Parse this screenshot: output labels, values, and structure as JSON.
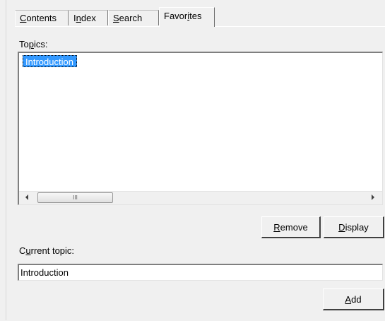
{
  "tabs": {
    "contents": {
      "pre": "",
      "key": "C",
      "post": "ontents"
    },
    "index": {
      "pre": "I",
      "key": "n",
      "post": "dex"
    },
    "search": {
      "pre": "",
      "key": "S",
      "post": "earch"
    },
    "favorites": {
      "pre": "Favor",
      "key": "i",
      "post": "tes"
    }
  },
  "topics": {
    "label": {
      "pre": "To",
      "key": "p",
      "post": "ics:"
    },
    "items": [
      "Introduction"
    ],
    "selected_index": 0
  },
  "scrollbar": {
    "left_icon": "chevron-left-icon",
    "right_icon": "chevron-right-icon",
    "thumb_grip": "III"
  },
  "buttons": {
    "remove": {
      "pre": "",
      "key": "R",
      "post": "emove"
    },
    "display": {
      "pre": "",
      "key": "D",
      "post": "isplay"
    },
    "add": {
      "pre": "",
      "key": "A",
      "post": "dd"
    }
  },
  "current_topic": {
    "label": {
      "pre": "C",
      "key": "u",
      "post": "rrent topic:"
    },
    "value": "Introduction"
  },
  "colors": {
    "selection": "#3399ff",
    "background": "#f0f0f0"
  }
}
